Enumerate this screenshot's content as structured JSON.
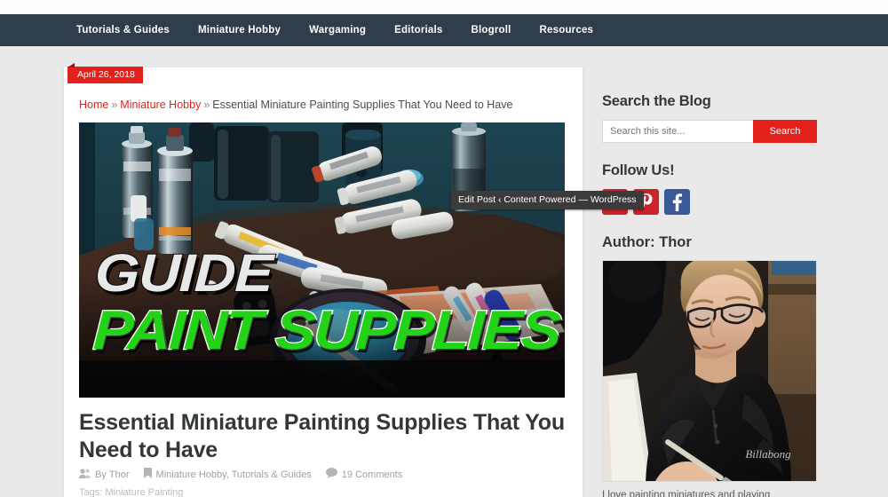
{
  "nav": {
    "items": [
      {
        "label": "Tutorials & Guides"
      },
      {
        "label": "Miniature Hobby"
      },
      {
        "label": "Wargaming"
      },
      {
        "label": "Editorials"
      },
      {
        "label": "Blogroll"
      },
      {
        "label": "Resources"
      }
    ]
  },
  "post": {
    "date_badge": "April 26, 2018",
    "breadcrumb": {
      "home": "Home",
      "sep1": "»",
      "category": "Miniature Hobby",
      "sep2": "»",
      "current": "Essential Miniature Painting Supplies That You Need to Have"
    },
    "featured_image": {
      "overlay_top": "GUIDE",
      "overlay_bottom": "PAINT SUPPLIES",
      "alt": "Assorted paint tubes, spray cans and a tin of blue paint on a workbench"
    },
    "title": "Essential Miniature Painting Supplies That You Need to Have",
    "meta": {
      "author_prefix": "By",
      "author": "Thor",
      "categories": "Miniature Hobby, Tutorials & Guides",
      "comments": "19 Comments"
    },
    "tags_label": "Tags:",
    "tags": "Miniature Painting"
  },
  "browser": {
    "tooltip": "Edit Post ‹ Content Powered — WordPress"
  },
  "sidebar": {
    "search": {
      "heading": "Search the Blog",
      "placeholder": "Search this site...",
      "value": "",
      "button": "Search"
    },
    "follow": {
      "heading": "Follow Us!",
      "links": [
        {
          "name": "youtube",
          "label": "YouTube"
        },
        {
          "name": "pinterest",
          "label": "Pinterest"
        },
        {
          "name": "facebook",
          "label": "Facebook"
        }
      ]
    },
    "author": {
      "heading": "Author: Thor",
      "photo_alt": "Thor, a man with glasses in a black polo shirt, painting a miniature",
      "bio": "I love painting miniatures and playing"
    }
  },
  "colors": {
    "nav_bg": "#2f3d4c",
    "accent_red": "#e2211c",
    "page_bg": "#e9e9e9",
    "card_bg": "#ffffff",
    "text_dark": "#33373a",
    "facebook_blue": "#3b5998",
    "youtube_red": "#cc2229",
    "overlay_green": "#22d317"
  }
}
